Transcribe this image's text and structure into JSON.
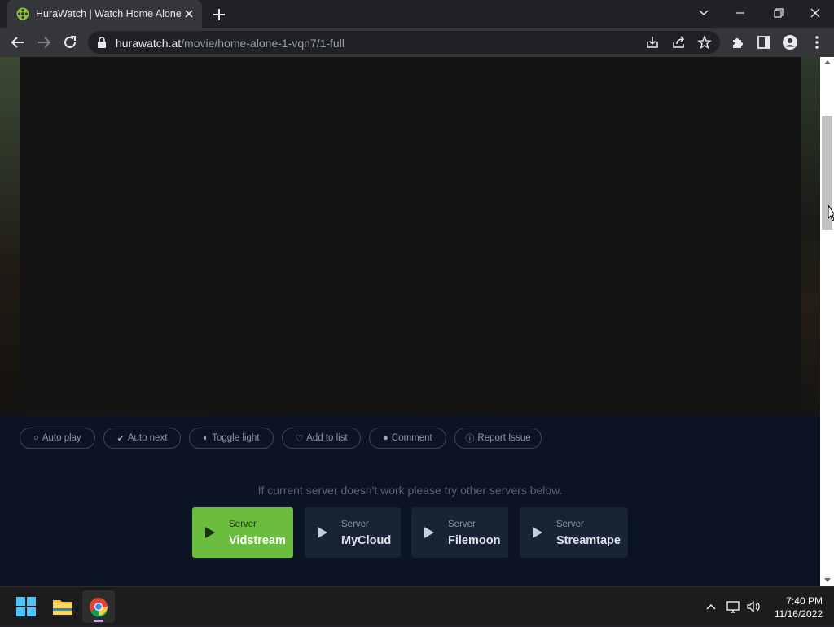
{
  "browser": {
    "tab_title": "HuraWatch | Watch Home Alone",
    "url_host": "hurawatch.at",
    "url_path": "/movie/home-alone-1-vqn7/1-full",
    "icons": [
      "favicon-icon",
      "close-icon",
      "new-tab-icon",
      "back-icon",
      "forward-icon",
      "reload-icon",
      "lock-icon",
      "install-icon",
      "share-icon",
      "bookmark-star-icon",
      "extensions-icon",
      "side-panel-icon",
      "profile-icon",
      "menu-icon"
    ]
  },
  "player_controls": [
    {
      "label": "Auto play",
      "icon": "circle-icon"
    },
    {
      "label": "Auto next",
      "icon": "check-circle-icon"
    },
    {
      "label": "Toggle light",
      "icon": "half-circle-icon"
    },
    {
      "label": "Add to list",
      "icon": "heart-icon"
    },
    {
      "label": "Comment",
      "icon": "comment-icon"
    },
    {
      "label": "Report Issue",
      "icon": "info-icon"
    }
  ],
  "notice": "If current server doesn't work please try other servers below.",
  "servers": [
    {
      "small": "Server",
      "name": "Vidstream",
      "active": true
    },
    {
      "small": "Server",
      "name": "MyCloud",
      "active": false
    },
    {
      "small": "Server",
      "name": "Filemoon",
      "active": false
    },
    {
      "small": "Server",
      "name": "Streamtape",
      "active": false
    }
  ],
  "taskbar": {
    "time": "7:40 PM",
    "date": "11/16/2022"
  },
  "colors": {
    "active_server": "#6bbd3d",
    "page_bg": "#0b1422"
  }
}
